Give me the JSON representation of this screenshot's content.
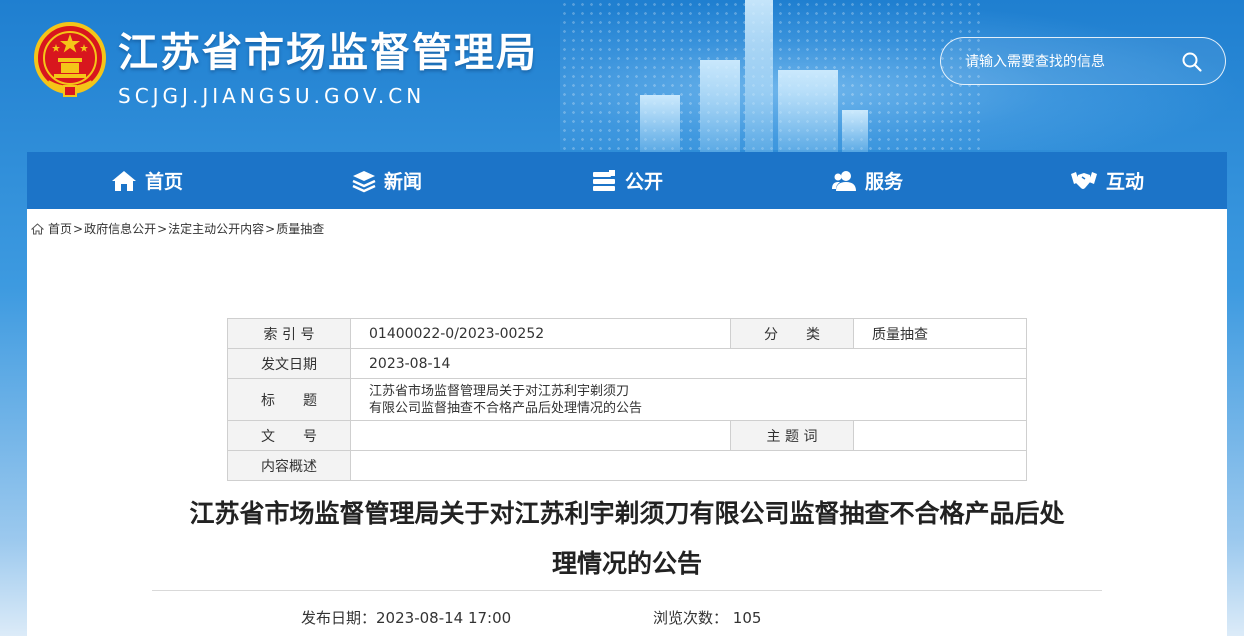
{
  "header": {
    "title": "江苏省市场监督管理局",
    "domain": "SCJGJ.JIANGSU.GOV.CN",
    "search_placeholder": "请输入需要查找的信息"
  },
  "nav": [
    {
      "label": "首页",
      "icon": "home-icon"
    },
    {
      "label": "新闻",
      "icon": "layers-icon"
    },
    {
      "label": "公开",
      "icon": "documents-icon"
    },
    {
      "label": "服务",
      "icon": "users-icon"
    },
    {
      "label": "互动",
      "icon": "handshake-icon"
    }
  ],
  "breadcrumb": [
    "首页",
    "政府信息公开",
    "法定主动公开内容",
    "质量抽查"
  ],
  "info": {
    "index_label": "索 引 号",
    "index_value": "01400022-0/2023-00252",
    "category_label": "分　　类",
    "category_value": "质量抽查",
    "date_label": "发文日期",
    "date_value": "2023-08-14",
    "title_label": "标　　题",
    "title_line1": "江苏省市场监督管理局关于对江苏利宇剃须刀",
    "title_line2": "有限公司监督抽查不合格产品后处理情况的公告",
    "docno_label": "文　　号",
    "docno_value": "",
    "subject_label": "主 题 词",
    "subject_value": "",
    "summary_label": "内容概述",
    "summary_value": ""
  },
  "article": {
    "title_line1": "江苏省市场监督管理局关于对江苏利宇剃须刀有限公司监督抽查不合格产品后处",
    "title_line2": "理情况的公告",
    "publish_label": "发布日期：",
    "publish_value": "2023-08-14 17:00",
    "views_label": "浏览次数：",
    "views_value": "105"
  },
  "colors": {
    "nav_bg": "#1c74c8",
    "emblem_red": "#d8161e",
    "emblem_gold": "#f5c518"
  }
}
